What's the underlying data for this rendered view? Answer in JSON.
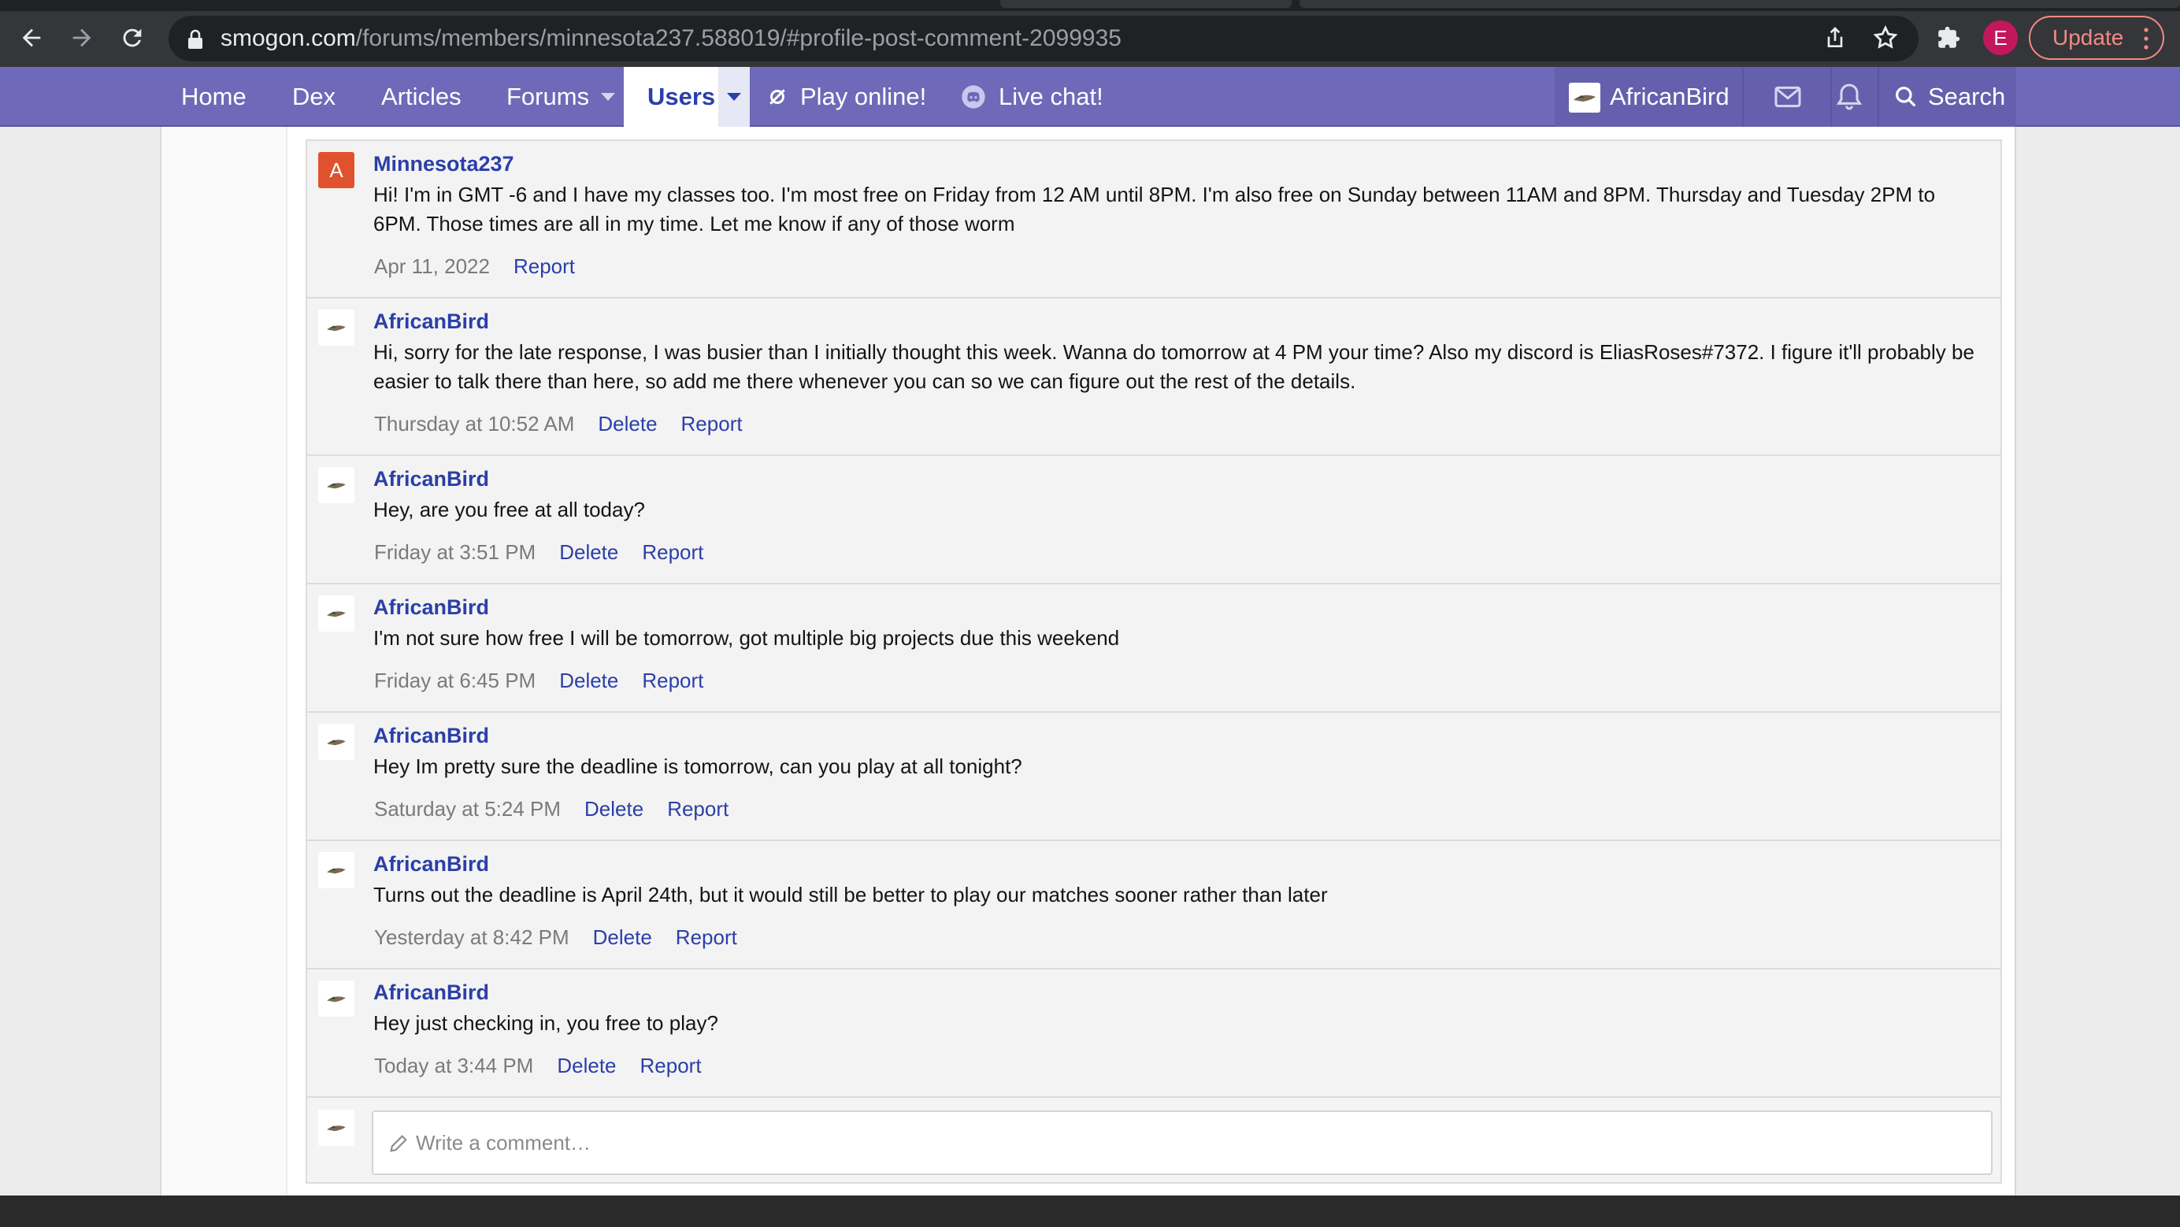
{
  "browser": {
    "url_host": "smogon.com",
    "url_path": "/forums/members/minnesota237.588019/#profile-post-comment-2099935",
    "profile_initial": "E",
    "update_label": "Update",
    "icons": [
      "back-arrow-icon",
      "forward-arrow-icon",
      "reload-icon",
      "lock-icon",
      "share-icon",
      "star-icon",
      "puzzle-icon",
      "more-vertical-icon"
    ]
  },
  "nav": {
    "items": [
      {
        "label": "Home"
      },
      {
        "label": "Dex"
      },
      {
        "label": "Articles"
      },
      {
        "label": "Forums"
      },
      {
        "label": "Users"
      },
      {
        "label": "Play online!"
      },
      {
        "label": "Live chat!"
      }
    ],
    "active": "Users",
    "username": "AfricanBird",
    "search_label": "Search",
    "icons": [
      "envelope-icon",
      "bell-icon",
      "search-icon",
      "showdown-icon",
      "discord-icon"
    ]
  },
  "colors": {
    "nav_bg": "#6e69b8",
    "link": "#2b3fa8",
    "letter_avatar": "#e0522d",
    "update_accent": "#f28b82"
  },
  "comments": [
    {
      "author": "Minnesota237",
      "avatar_letter": "A",
      "text": "Hi! I'm in GMT -6 and I have my classes too. I'm most free on Friday from 12 AM until 8PM. I'm also free on Sunday between 11AM and 8PM. Thursday and Tuesday 2PM to 6PM. Those times are all in my time. Let me know if any of those worm",
      "time": "Apr 11, 2022",
      "actions": [
        "Report"
      ]
    },
    {
      "author": "AfricanBird",
      "text": "Hi, sorry for the late response, I was busier than I initially thought this week. Wanna do tomorrow at 4 PM your time? Also my discord is EliasRoses#7372. I figure it'll probably be easier to talk there than here, so add me there whenever you can so we can figure out the rest of the details.",
      "time": "Thursday at 10:52 AM",
      "actions": [
        "Delete",
        "Report"
      ]
    },
    {
      "author": "AfricanBird",
      "text": "Hey, are you free at all today?",
      "time": "Friday at 3:51 PM",
      "actions": [
        "Delete",
        "Report"
      ]
    },
    {
      "author": "AfricanBird",
      "text": "I'm not sure how free I will be tomorrow, got multiple big projects due this weekend",
      "time": "Friday at 6:45 PM",
      "actions": [
        "Delete",
        "Report"
      ]
    },
    {
      "author": "AfricanBird",
      "text": "Hey Im pretty sure the deadline is tomorrow, can you play at all tonight?",
      "time": "Saturday at 5:24 PM",
      "actions": [
        "Delete",
        "Report"
      ]
    },
    {
      "author": "AfricanBird",
      "text": "Turns out the deadline is April 24th, but it would still be better to play our matches sooner rather than later",
      "time": "Yesterday at 8:42 PM",
      "actions": [
        "Delete",
        "Report"
      ]
    },
    {
      "author": "AfricanBird",
      "text": "Hey just checking in, you free to play?",
      "time": "Today at 3:44 PM",
      "actions": [
        "Delete",
        "Report"
      ]
    }
  ],
  "write_comment": {
    "placeholder": "Write a comment…"
  }
}
